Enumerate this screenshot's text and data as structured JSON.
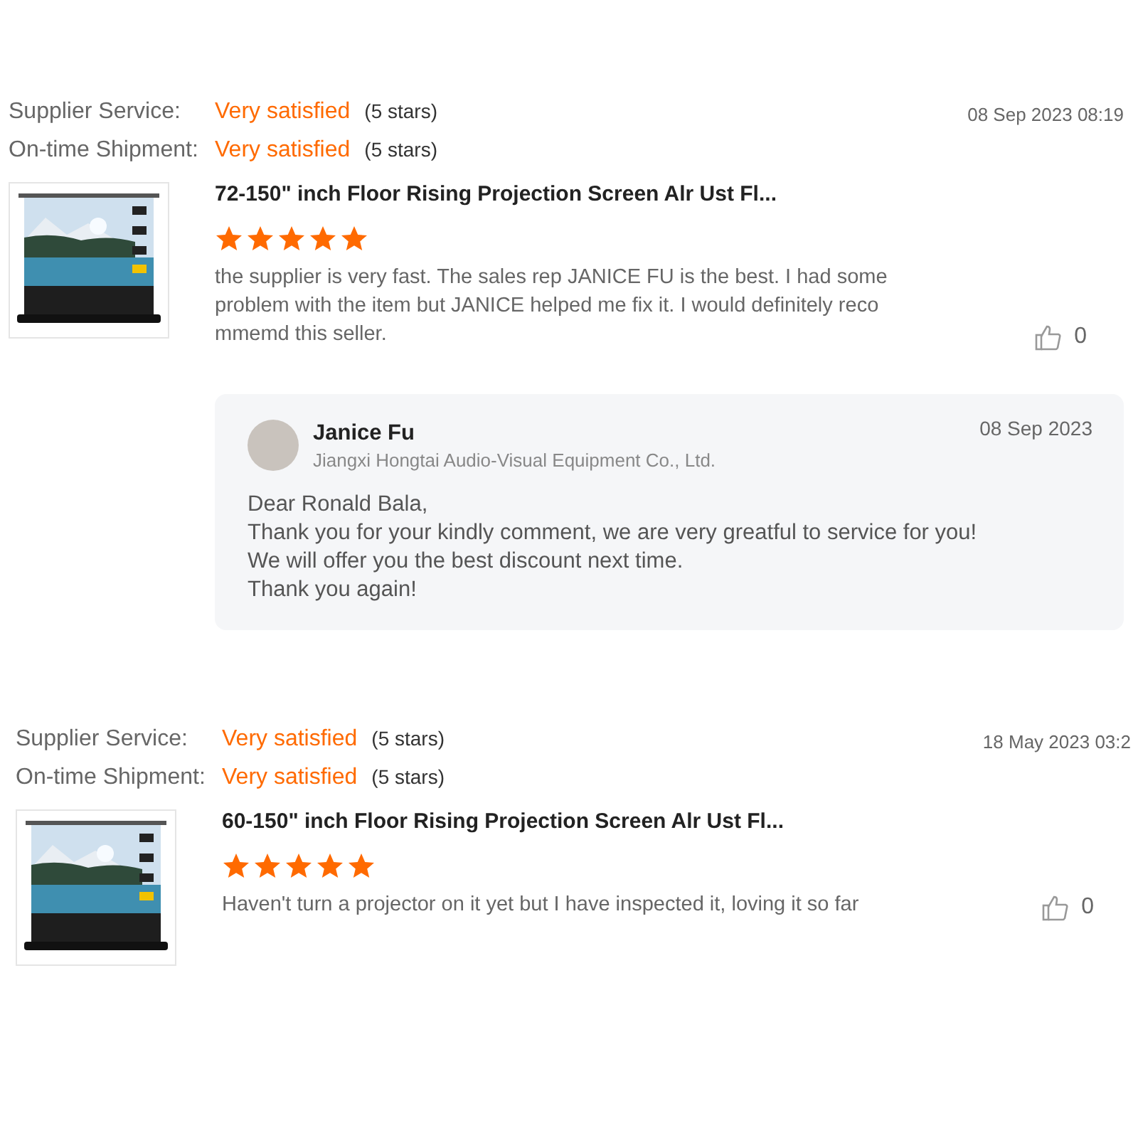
{
  "reviews": [
    {
      "ratings": [
        {
          "label": "Supplier Service:",
          "value": "Very satisfied",
          "note": "(5 stars)"
        },
        {
          "label": "On-time Shipment:",
          "value": "Very satisfied",
          "note": "(5 stars)"
        }
      ],
      "date": "08 Sep 2023 08:19",
      "product": {
        "title": "72-150\" inch Floor Rising Projection Screen Alr Ust Fl...",
        "stars": 5
      },
      "comment": "the supplier is very fast. The sales rep JANICE FU is the best. I had some problem with the item but JANICE helped me fix it. I would definitely reco mmemd this seller.",
      "likes": "0",
      "reply": {
        "name": "Janice Fu",
        "company": "Jiangxi Hongtai Audio-Visual Equipment Co., Ltd.",
        "date": "08 Sep 2023",
        "message": "Dear Ronald Bala,\nThank you for your kindly comment, we are very greatful to service for you!\nWe will offer you the best discount next time.\nThank you again!"
      }
    },
    {
      "ratings": [
        {
          "label": "Supplier Service:",
          "value": "Very satisfied",
          "note": "(5 stars)"
        },
        {
          "label": "On-time Shipment:",
          "value": "Very satisfied",
          "note": "(5 stars)"
        }
      ],
      "date": "18 May 2023 03:2",
      "product": {
        "title": "60-150\" inch Floor Rising Projection Screen Alr Ust Fl...",
        "stars": 5
      },
      "comment": "Haven't turn a projector on it yet but I have inspected it, loving it so far",
      "likes": "0"
    }
  ]
}
